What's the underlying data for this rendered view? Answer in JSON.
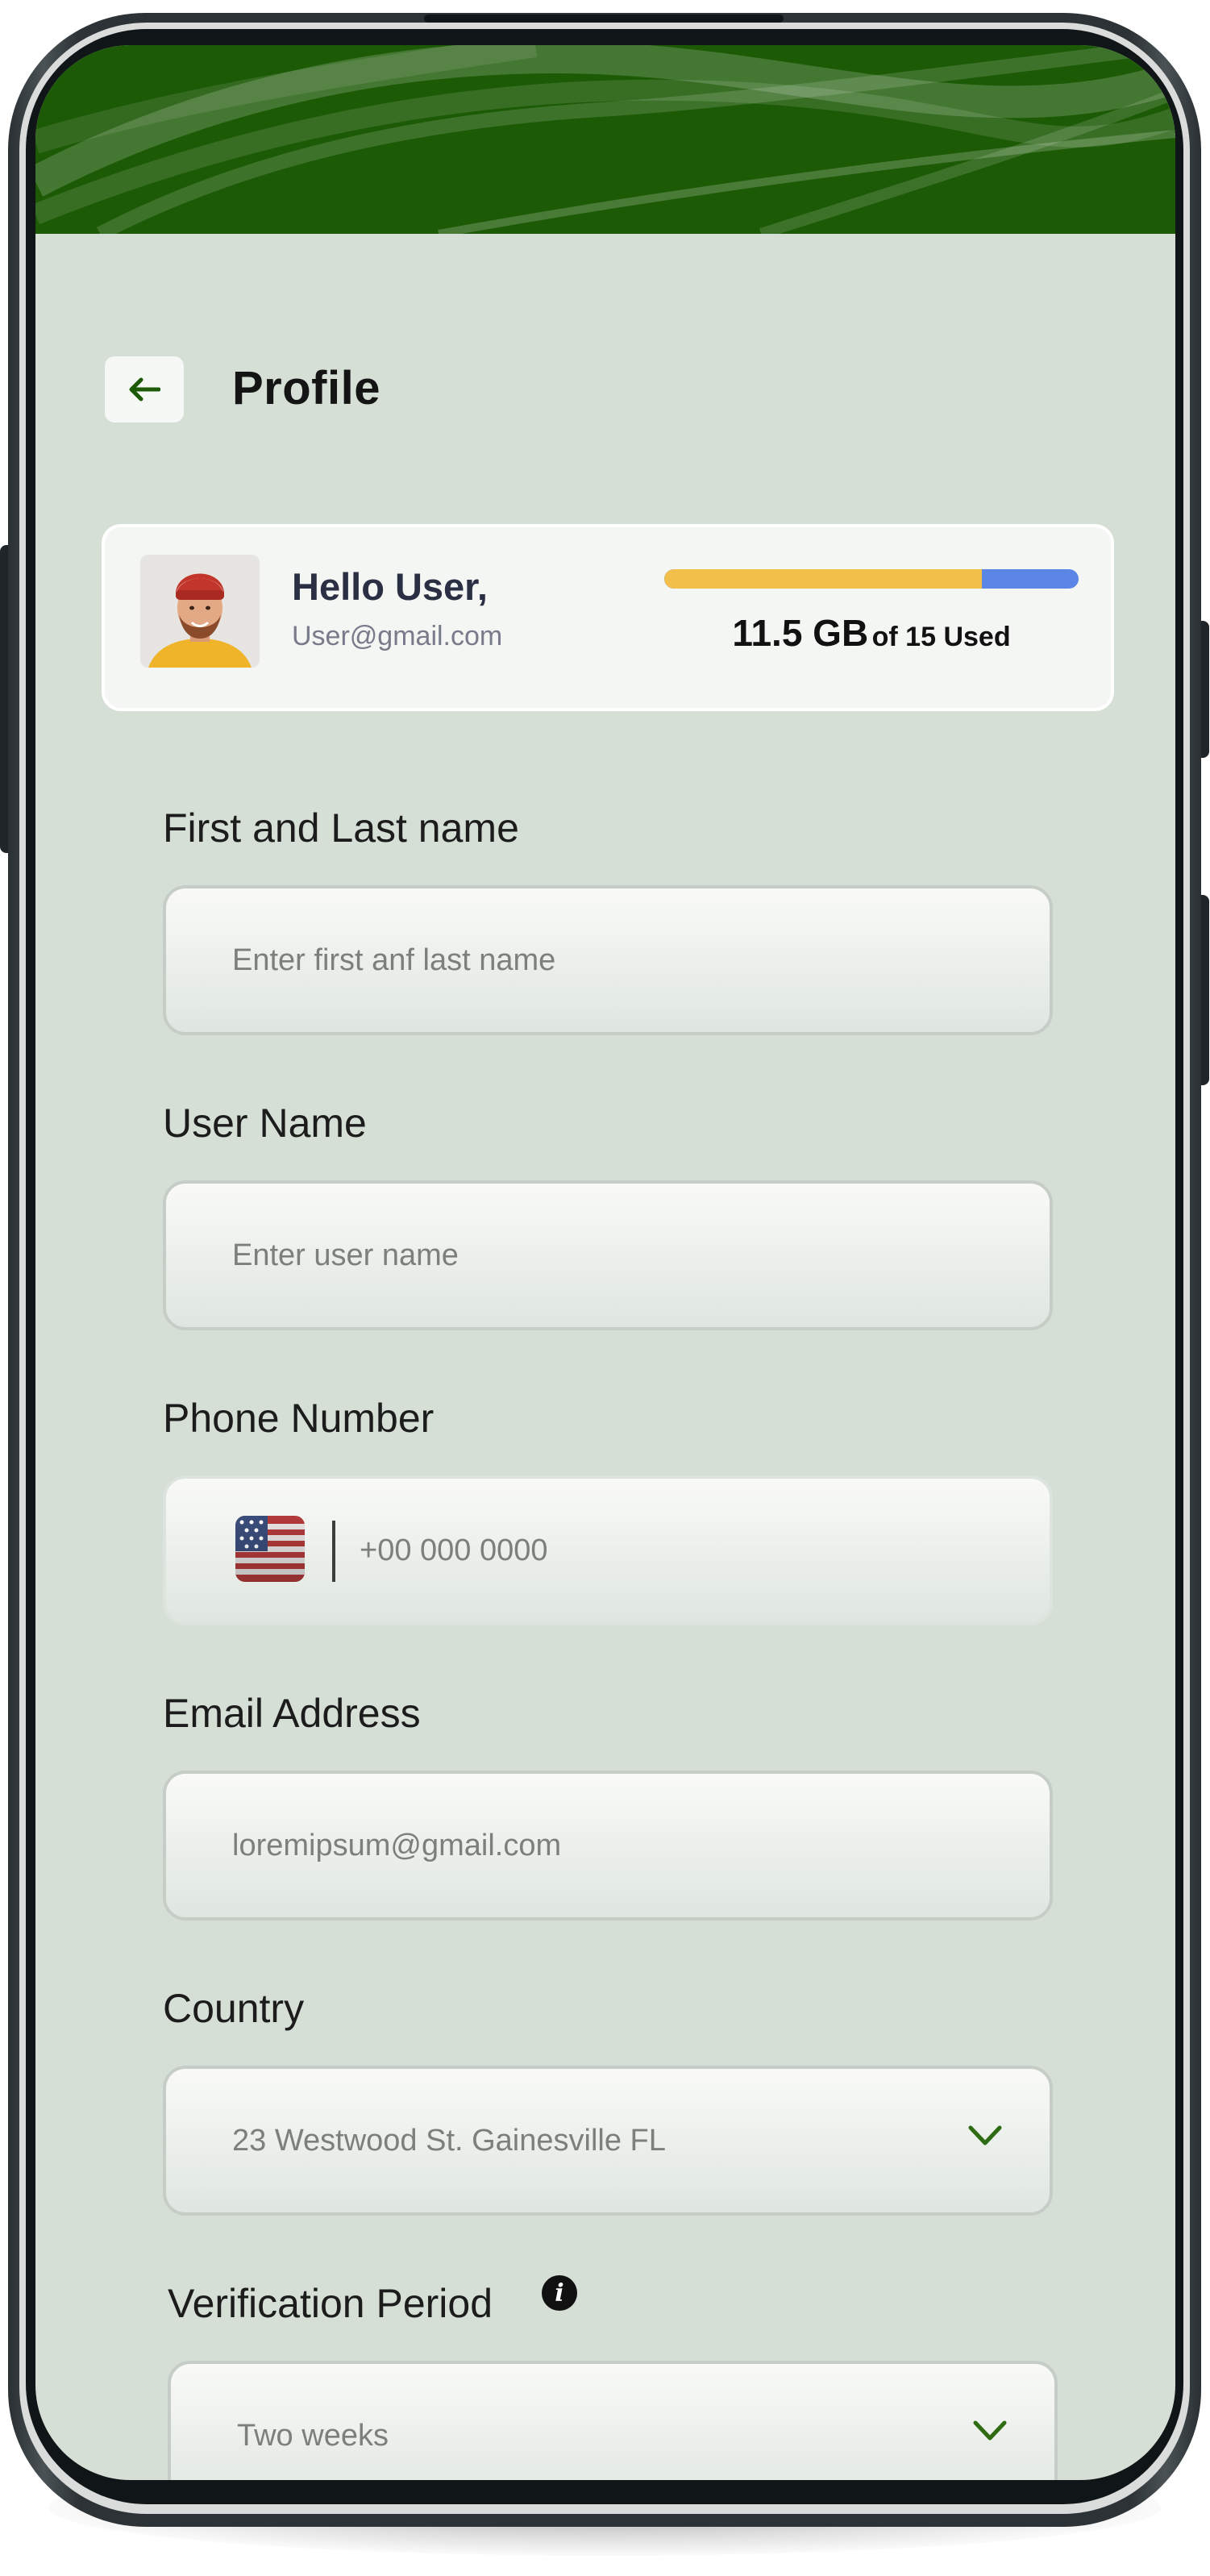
{
  "header": {
    "title": "Profile",
    "back_icon": "arrow-left-icon"
  },
  "user": {
    "greeting": "Hello User,",
    "email": "User@gmail.com"
  },
  "storage": {
    "used": "11.5 GB",
    "suffix": "of 15 Used",
    "used_fraction": 0.7667,
    "used_color": "#f2c04a",
    "free_color": "#5b86e5"
  },
  "form": {
    "name": {
      "label": "First and Last name",
      "placeholder": "Enter first anf last name"
    },
    "username": {
      "label": "User Name",
      "placeholder": "Enter user name"
    },
    "phone": {
      "label": "Phone Number",
      "placeholder": "+00 000 0000",
      "flag_icon": "us-flag-icon"
    },
    "email": {
      "label": "Email Address",
      "placeholder": "loremipsum@gmail.com"
    },
    "country": {
      "label": "Country",
      "value": "23 Westwood St. Gainesville FL"
    },
    "verification": {
      "label": "Verification Period",
      "value": "Two weeks",
      "info_icon": "info-icon"
    }
  },
  "colors": {
    "header_green": "#1c5a06",
    "background": "#d5dfd5",
    "chevron_green": "#2f6b12"
  }
}
